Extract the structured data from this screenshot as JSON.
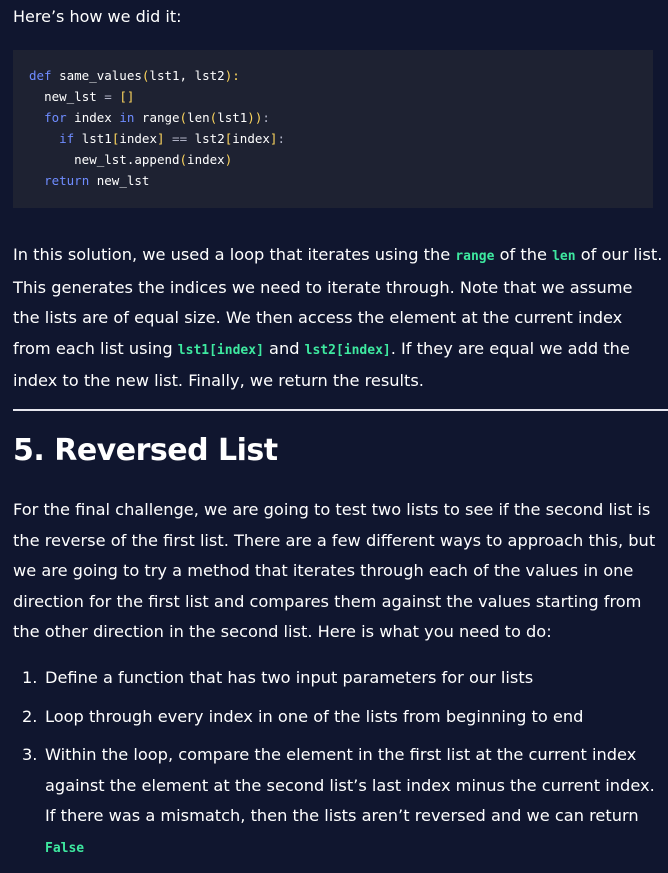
{
  "intro_text": "Here’s how we did it:",
  "code_lines": {
    "l1": {
      "kw": "def",
      "name": " same_values",
      "open": "(",
      "params": "lst1, lst2",
      "close": "):"
    },
    "l2": {
      "indent": "  ",
      "var": "new_lst",
      "op": " = ",
      "val": "[]"
    },
    "l3": {
      "indent": "  ",
      "kw1": "for",
      "var": " index ",
      "kw2": "in",
      "rest1": " range",
      "p1": "(",
      "rest2": "len",
      "p2": "(",
      "arg": "lst1",
      "p3": "))",
      "colon": ":"
    },
    "l4": {
      "indent": "    ",
      "kw": "if",
      "a": " lst1",
      "b1": "[",
      "i1": "index",
      "b2": "]",
      "op": " == ",
      "c": "lst2",
      "b3": "[",
      "i2": "index",
      "b4": "]",
      "colon": ":"
    },
    "l5": {
      "indent": "      ",
      "obj": "new_lst.append",
      "p1": "(",
      "arg": "index",
      "p2": ")"
    },
    "l6": {
      "indent": "  ",
      "kw": "return",
      "val": " new_lst"
    }
  },
  "paragraph1": {
    "t1": "In this solution, we used a loop that iterates using the ",
    "c1": "range",
    "t2": " of the ",
    "c2": "len",
    "t3": " of our list. This generates the indices we need to iterate through. Note that we assume the lists are of equal size. We then access the element at the current index from each list using ",
    "c3": "lst1[index]",
    "t4": " and ",
    "c4": "lst2[index]",
    "t5": ". If they are equal we add the index to the new list. Finally, we return the results."
  },
  "section_heading": "5. Reversed List",
  "paragraph2": "For the final challenge, we are going to test two lists to see if the second list is the reverse of the first list. There are a few different ways to approach this, but we are going to try a method that iterates through each of the values in one direction for the first list and compares them against the values starting from the other direction in the second list. Here is what you need to do:",
  "steps": [
    {
      "num": "1.",
      "text": "Define a function that has two input parameters for our lists"
    },
    {
      "num": "2.",
      "text": "Loop through every index in one of the lists from beginning to end"
    },
    {
      "num": "3.",
      "text": "Within the loop, compare the element in the first list at the current index against the element at the second list’s last index minus the current index. If there was a mismatch, then the lists aren’t reversed and we can return ",
      "code": "False"
    }
  ],
  "colors": {
    "background": "#10162f",
    "code_background": "#1e2232",
    "inline_code": "#3ee9a0",
    "keyword": "#6f8cff",
    "punctuation": "#ffd75e"
  }
}
